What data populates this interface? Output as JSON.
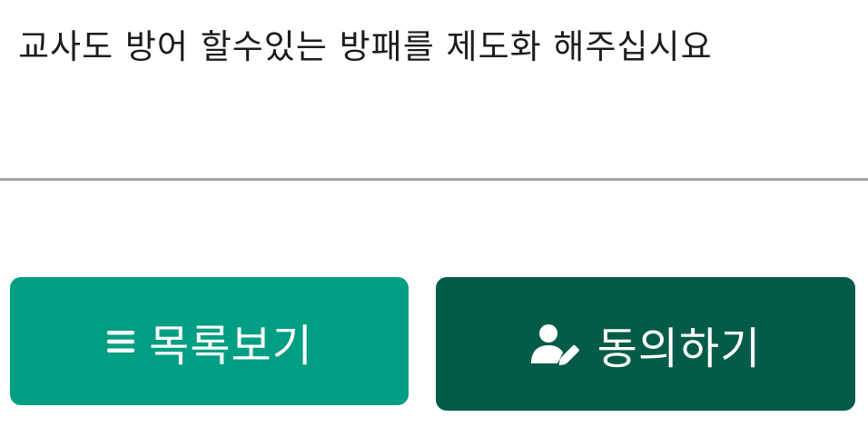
{
  "petition": {
    "text": "교사도 방어 할수있는 방패를 제도화 해주십시요"
  },
  "buttons": {
    "list_label": "목록보기",
    "agree_label": "동의하기"
  },
  "icons": {
    "list": "list-icon",
    "agree": "user-pen-icon"
  },
  "colors": {
    "list_button": "#009e82",
    "agree_button": "#045c48",
    "divider": "#a3a3a3"
  }
}
